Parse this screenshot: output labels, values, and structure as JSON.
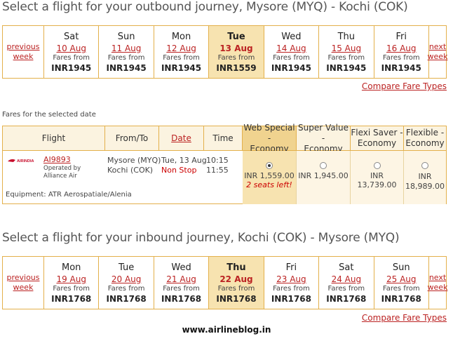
{
  "outbound": {
    "heading": "Select a flight for your outbound journey, Mysore (MYQ) - Kochi (COK)",
    "prev": [
      "previous",
      "week"
    ],
    "next": [
      "next",
      "week"
    ],
    "days": [
      {
        "day": "Sat",
        "date": "10 Aug",
        "label": "Fares from",
        "price": "INR1945",
        "selected": false
      },
      {
        "day": "Sun",
        "date": "11 Aug",
        "label": "Fares from",
        "price": "INR1945",
        "selected": false
      },
      {
        "day": "Mon",
        "date": "12 Aug",
        "label": "Fares from",
        "price": "INR1945",
        "selected": false
      },
      {
        "day": "Tue",
        "date": "13 Aug",
        "label": "Fares from",
        "price": "INR1559",
        "selected": true
      },
      {
        "day": "Wed",
        "date": "14 Aug",
        "label": "Fares from",
        "price": "INR1945",
        "selected": false
      },
      {
        "day": "Thu",
        "date": "15 Aug",
        "label": "Fares from",
        "price": "INR1945",
        "selected": false
      },
      {
        "day": "Fri",
        "date": "16 Aug",
        "label": "Fares from",
        "price": "INR1945",
        "selected": false
      }
    ],
    "compare": "Compare Fare Types"
  },
  "fares_caption": "Fares for the selected date",
  "flight_table": {
    "headers": {
      "flight": "Flight",
      "from_to": "From/To",
      "date": "Date",
      "time": "Time",
      "web_special": [
        "Web Special -",
        "Economy"
      ],
      "super_value": [
        "Super Value -",
        "Economy"
      ],
      "flexi_saver": [
        "Flexi Saver -",
        "Economy"
      ],
      "flexible": [
        "Flexible -",
        "Economy"
      ]
    },
    "row": {
      "airline_logo_text": "AIRINDIA",
      "flight_no": "AI9893",
      "operated_by": [
        "Operated by",
        "Alliance Air"
      ],
      "from": "Mysore (MYQ)",
      "to": "Kochi (COK)",
      "date": "Tue, 13 Aug",
      "stops": "Non Stop",
      "depart": "10:15",
      "arrive": "11:55",
      "equipment": "Equipment: ATR Aerospatiale/Alenia",
      "fares": {
        "web_special": {
          "price": "INR 1,559.00",
          "note": "2 seats left!",
          "selected": true
        },
        "super_value": {
          "price": "INR 1,945.00",
          "selected": false
        },
        "flexi_saver": {
          "price": "INR 13,739.00",
          "selected": false
        },
        "flexible": {
          "price": [
            "INR",
            "18,989.00"
          ],
          "selected": false
        }
      }
    }
  },
  "inbound": {
    "heading": "Select a flight for your inbound journey, Kochi (COK) - Mysore (MYQ)",
    "prev": [
      "previous",
      "week"
    ],
    "next": [
      "next",
      "week"
    ],
    "days": [
      {
        "day": "Mon",
        "date": "19 Aug",
        "label": "Fares from",
        "price": "INR1768",
        "selected": false
      },
      {
        "day": "Tue",
        "date": "20 Aug",
        "label": "Fares from",
        "price": "INR1768",
        "selected": false
      },
      {
        "day": "Wed",
        "date": "21 Aug",
        "label": "Fares from",
        "price": "INR1768",
        "selected": false
      },
      {
        "day": "Thu",
        "date": "22 Aug",
        "label": "Fares from",
        "price": "INR1768",
        "selected": true
      },
      {
        "day": "Fri",
        "date": "23 Aug",
        "label": "Fares from",
        "price": "INR1768",
        "selected": false
      },
      {
        "day": "Sat",
        "date": "24 Aug",
        "label": "Fares from",
        "price": "INR1768",
        "selected": false
      },
      {
        "day": "Sun",
        "date": "25 Aug",
        "label": "Fares from",
        "price": "INR1768",
        "selected": false
      }
    ],
    "compare": "Compare Fare Types"
  },
  "footer": "www.airlineblog.in",
  "colors": {
    "accent": "#b22222",
    "border": "#e3b04b",
    "selected_bg": "#f7e3b0"
  }
}
